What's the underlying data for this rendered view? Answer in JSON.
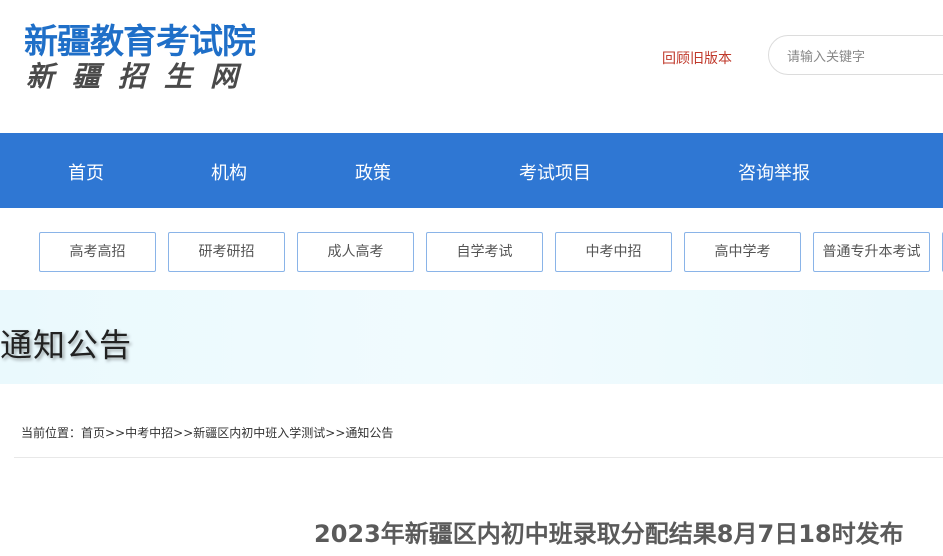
{
  "header": {
    "logo_title": "新疆教育考试院",
    "logo_subtitle": "新疆招生网",
    "old_version_link": "回顾旧版本",
    "search_placeholder": "请输入关键字"
  },
  "main_nav": {
    "items": [
      "首页",
      "机构",
      "政策",
      "考试项目",
      "咨询举报"
    ]
  },
  "categories": {
    "items": [
      "高考高招",
      "研考研招",
      "成人高考",
      "自学考试",
      "中考中招",
      "高中学考",
      "普通专升本考试"
    ]
  },
  "banner": {
    "title": "通知公告"
  },
  "breadcrumb": {
    "prefix": "当前位置：",
    "items": [
      "首页",
      "中考中招",
      "新疆区内初中班入学测试",
      "通知公告"
    ],
    "separator": ">>"
  },
  "article": {
    "title": "2023年新疆区内初中班录取分配结果8月7日18时发布"
  },
  "colors": {
    "brand_blue": "#2f77d3",
    "logo_blue": "#1f6fc8",
    "link_red": "#c0392b",
    "tab_border": "#8ab4e8"
  }
}
